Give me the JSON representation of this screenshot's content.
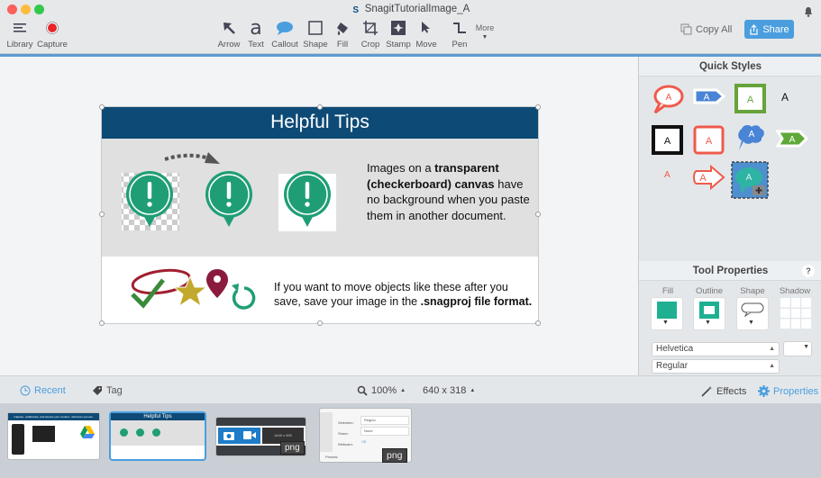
{
  "window": {
    "title": "SnagitTutorialImage_A",
    "traffic_lights": [
      "close",
      "minimize",
      "maximize"
    ]
  },
  "toolbar": {
    "left": [
      {
        "label": "Library",
        "icon": "hamburger-icon"
      },
      {
        "label": "Capture",
        "icon": "record-icon"
      }
    ],
    "tools": [
      {
        "label": "Arrow",
        "icon": "arrow-icon"
      },
      {
        "label": "Text",
        "icon": "text-icon"
      },
      {
        "label": "Callout",
        "icon": "callout-icon"
      },
      {
        "label": "Shape",
        "icon": "shape-icon"
      },
      {
        "label": "Fill",
        "icon": "fill-icon"
      },
      {
        "label": "Crop",
        "icon": "crop-icon"
      },
      {
        "label": "Stamp",
        "icon": "stamp-icon"
      },
      {
        "label": "Move",
        "icon": "move-icon"
      },
      {
        "label": "Pen",
        "icon": "pen-icon"
      },
      {
        "label": "More",
        "icon": "chevron-down-icon"
      }
    ],
    "copy_all_label": "Copy All",
    "share_label": "Share"
  },
  "canvas": {
    "image": {
      "header": "Helpful Tips",
      "text1_parts": [
        "Images on a ",
        "transparent (checkerboard) canvas",
        " have no background when you paste them in another document."
      ],
      "text2_parts": [
        "If you want to move objects like these after you save, save your image in the ",
        ".snagproj file format."
      ]
    }
  },
  "quick_styles": {
    "title": "Quick Styles",
    "item_letter": "A"
  },
  "tool_properties": {
    "title": "Tool Properties",
    "help": "?",
    "labels": [
      "Fill",
      "Outline",
      "Shape",
      "Shadow"
    ],
    "fill_color": "#1fb092",
    "font": "Helvetica",
    "style": "Regular"
  },
  "bottom_bar": {
    "recent_label": "Recent",
    "tag_label": "Tag",
    "zoom": "100%",
    "dimensions": "640 x 318",
    "effects_label": "Effects",
    "properties_label": "Properties"
  },
  "tray": {
    "items": [
      {
        "title": "Capture, collaborate, and access your content - wherever you are."
      },
      {
        "title": "Helpful Tips"
      },
      {
        "badge": "png",
        "left_value": "1440",
        "right_value": "900"
      },
      {
        "badge": "png",
        "rows": [
          "Selection:",
          "Share:",
          "Webcam:"
        ],
        "values": [
          "Region",
          "None",
          "Off"
        ],
        "footer": "Presets"
      }
    ]
  },
  "colors": {
    "accent": "#4a9ede",
    "header_blue": "#0e4a76",
    "green": "#1fa078"
  }
}
